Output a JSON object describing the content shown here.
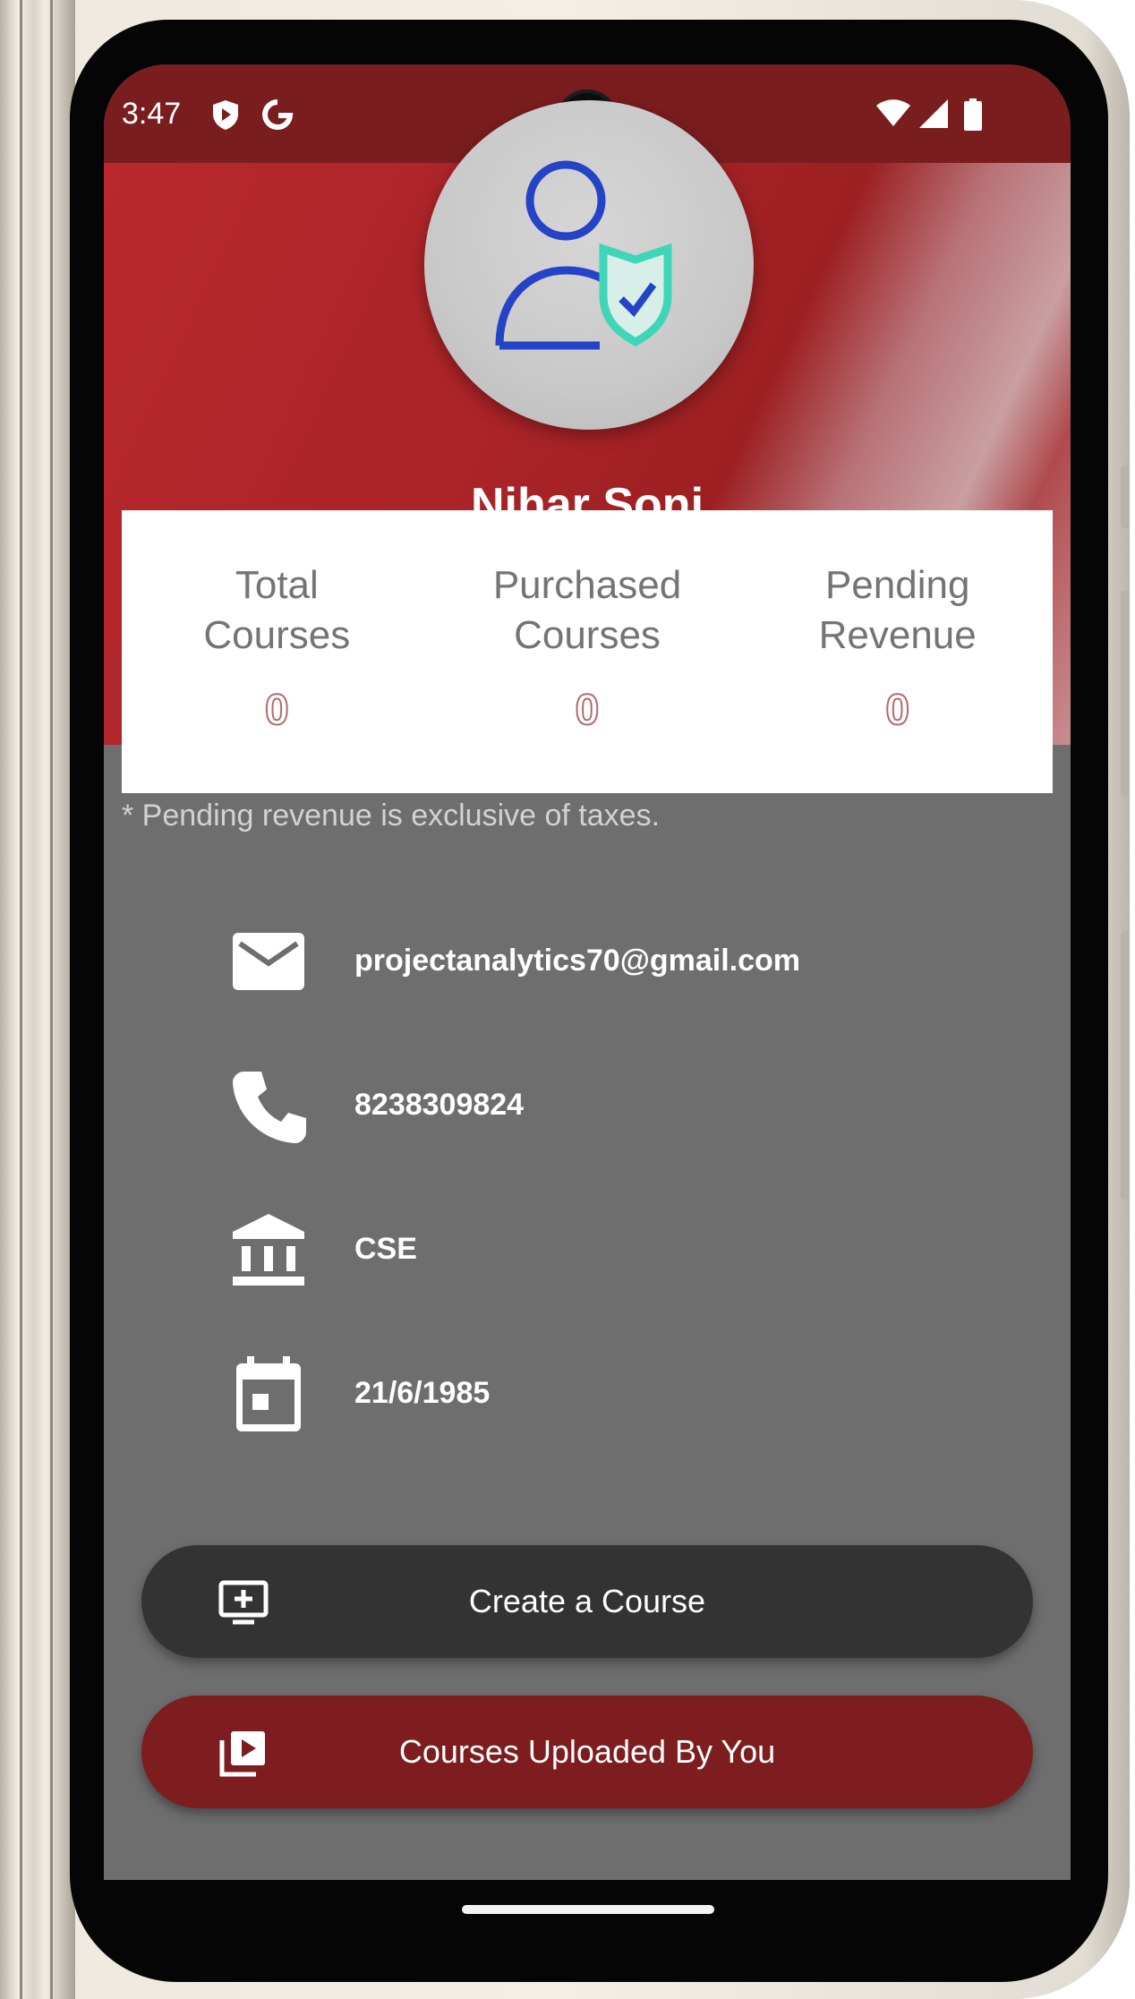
{
  "status_bar": {
    "time": "3:47"
  },
  "profile": {
    "name": "Nihar Soni"
  },
  "stats": [
    {
      "label": "Total\nCourses",
      "value": "0"
    },
    {
      "label": "Purchased\nCourses",
      "value": "0"
    },
    {
      "label": "Pending\nRevenue",
      "value": "0"
    }
  ],
  "note": "* Pending revenue is exclusive of taxes.",
  "info": {
    "email": "projectanalytics70@gmail.com",
    "phone": "8238309824",
    "department": "CSE",
    "dob": "21/6/1985"
  },
  "buttons": {
    "create_course": "Create a Course",
    "uploaded_courses": "Courses Uploaded By You"
  },
  "colors": {
    "header_red": "#b8282c",
    "status_bar": "#7a1d1f",
    "create_button": "#333333",
    "uploaded_button": "#7d1d1f",
    "body_bg": "#6e6e6e"
  },
  "icons": [
    "shield-icon",
    "google-icon",
    "wifi-icon",
    "signal-icon",
    "battery-icon",
    "user-shield-icon",
    "email-icon",
    "phone-icon",
    "bank-icon",
    "calendar-icon",
    "add-to-screen-icon",
    "video-library-icon"
  ]
}
